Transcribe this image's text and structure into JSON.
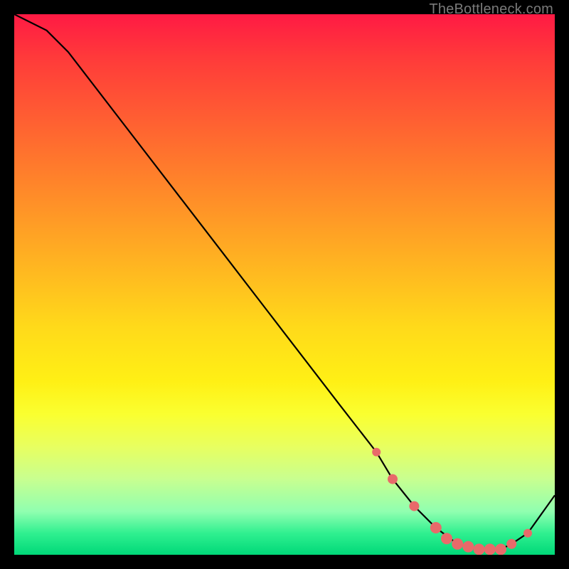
{
  "attribution": "TheBottleneck.com",
  "chart_data": {
    "type": "line",
    "title": "",
    "xlabel": "",
    "ylabel": "",
    "xlim": [
      0,
      100
    ],
    "ylim": [
      0,
      100
    ],
    "series": [
      {
        "name": "bottleneck-curve",
        "x": [
          0,
          6,
          10,
          20,
          30,
          40,
          50,
          60,
          67,
          70,
          74,
          78,
          82,
          86,
          88,
          90,
          92,
          95,
          100
        ],
        "values": [
          100,
          97,
          93,
          80,
          67,
          54,
          41,
          28,
          19,
          14,
          9,
          5,
          2,
          1,
          1,
          1,
          2,
          4,
          11
        ]
      }
    ],
    "markers": {
      "name": "highlight-dots",
      "color": "#e86a6a",
      "x": [
        67,
        70,
        74,
        78,
        80,
        82,
        84,
        86,
        88,
        90,
        92,
        95
      ],
      "values": [
        19,
        14,
        9,
        5,
        3,
        2,
        1.5,
        1,
        1,
        1,
        2,
        4
      ]
    }
  }
}
